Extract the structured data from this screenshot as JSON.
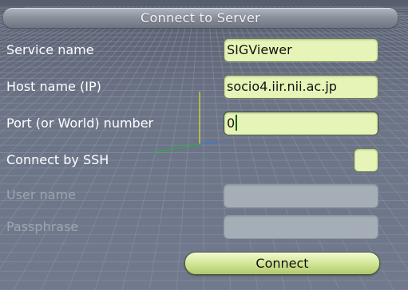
{
  "dialog": {
    "title": "Connect to Server"
  },
  "fields": {
    "service_name": {
      "label": "Service name",
      "value": "SIGViewer"
    },
    "host_name": {
      "label": "Host name (IP)",
      "value": "socio4.iir.nii.ac.jp"
    },
    "port": {
      "label": "Port (or World) number",
      "value": "0"
    },
    "ssh": {
      "label": "Connect by SSH",
      "checked": false
    },
    "user_name": {
      "label": "User name",
      "value": "",
      "enabled": false
    },
    "passphrase": {
      "label": "Passphrase",
      "value": "",
      "enabled": false
    }
  },
  "actions": {
    "connect_label": "Connect"
  },
  "colors": {
    "field_bg": "#e6f5b7",
    "field_disabled_bg": "#a5adb6",
    "label_text": "#ffffff",
    "label_disabled_text": "#9ea4b1",
    "button_gradient_top": "#f1fbcf",
    "button_gradient_bottom": "#b3c96d",
    "background": "#6c7487",
    "grid_lines": "#8c94a8"
  }
}
